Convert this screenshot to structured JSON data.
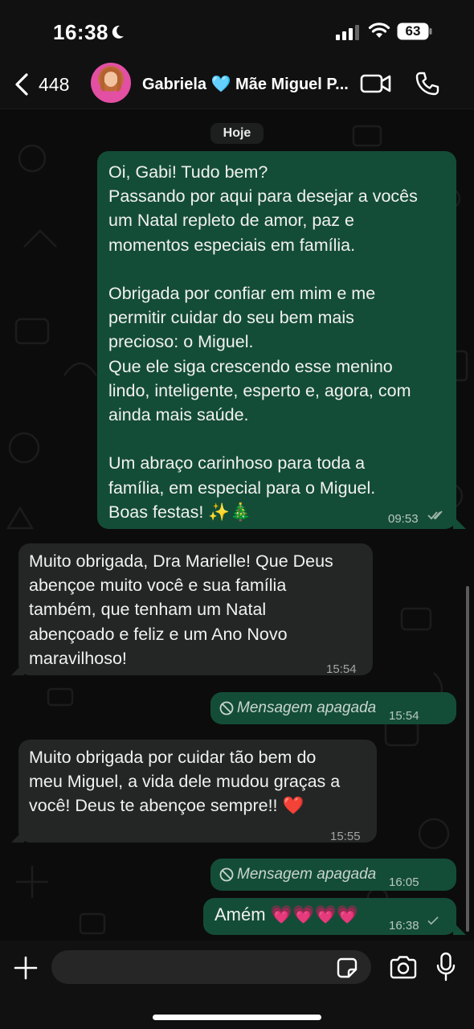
{
  "status_bar": {
    "time": "16:38",
    "battery": "63"
  },
  "header": {
    "back_count": "448",
    "contact_name": "Gabriela 🩵 Mãe Miguel P..."
  },
  "chat": {
    "date_label": "Hoje",
    "messages": [
      {
        "direction": "out",
        "text": "Oi, Gabi! Tudo bem?\nPassando por aqui para desejar a vocês\num Natal repleto de amor, paz e\nmomentos especiais em família.\n\nObrigada por confiar em mim e me\npermitir cuidar do seu bem mais\nprecioso: o Miguel.\nQue ele siga crescendo esse menino\nlindo, inteligente, esperto e, agora, com\nainda mais saúde.\n\nUm abraço carinhoso para toda a\nfamília, em especial para o Miguel.\nBoas festas! ✨🎄",
        "time": "09:53",
        "status": "read"
      },
      {
        "direction": "in",
        "text": "Muito obrigada, Dra Marielle! Que Deus\nabençoe muito você e sua família\ntambém, que tenham um Natal\nabençoado e feliz e um Ano Novo\nmaravilhoso!",
        "time": "15:54"
      },
      {
        "direction": "out",
        "text": "Mensagem apagada",
        "time": "15:54",
        "deleted": true
      },
      {
        "direction": "in",
        "text": "Muito obrigada por cuidar tão bem do\nmeu Miguel, a vida dele mudou graças a\nvocê! Deus te abençoe sempre!! ❤️",
        "time": "15:55"
      },
      {
        "direction": "out",
        "text": "Mensagem apagada",
        "time": "16:05",
        "deleted": true
      },
      {
        "direction": "out",
        "text": "Amém 💗💗💗💗",
        "time": "16:38",
        "status": "sent"
      }
    ]
  },
  "composer": {
    "placeholder": ""
  },
  "colors": {
    "outgoing_bubble": "#144d37",
    "incoming_bubble": "#242626",
    "background": "#0c0c0c",
    "accent": "#25d366"
  }
}
